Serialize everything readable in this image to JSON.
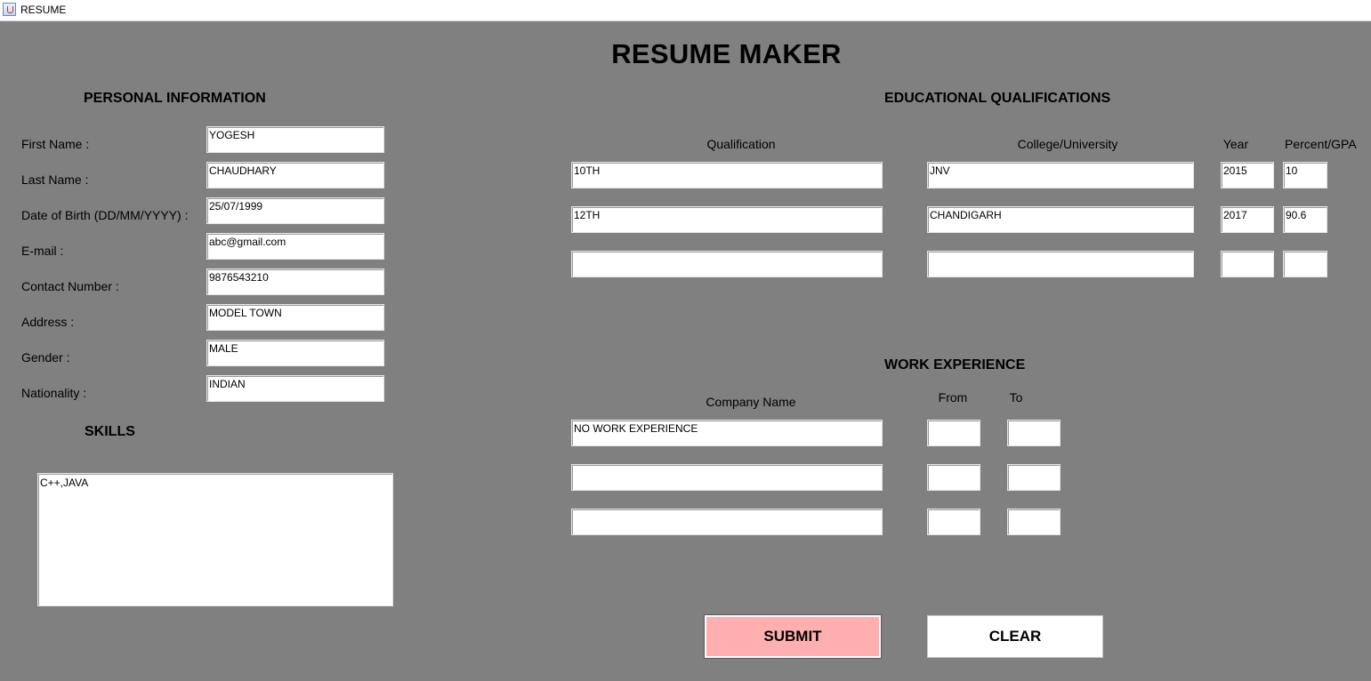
{
  "window": {
    "title": "RESUME",
    "icon": "java-app-icon"
  },
  "page_title": "RESUME MAKER",
  "personal": {
    "heading": "PERSONAL INFORMATION",
    "fields": [
      {
        "label": "First Name :",
        "value": "YOGESH"
      },
      {
        "label": "Last Name :",
        "value": "CHAUDHARY"
      },
      {
        "label": "Date of Birth (DD/MM/YYYY) :",
        "value": "25/07/1999"
      },
      {
        "label": "E-mail :",
        "value": "abc@gmail.com"
      },
      {
        "label": "Contact Number :",
        "value": "9876543210"
      },
      {
        "label": "Address :",
        "value": "MODEL TOWN"
      },
      {
        "label": "Gender :",
        "value": "MALE"
      },
      {
        "label": "Nationality :",
        "value": "INDIAN"
      }
    ]
  },
  "skills": {
    "heading": "SKILLS",
    "value": "C++,JAVA"
  },
  "education": {
    "heading": "EDUCATIONAL QUALIFICATIONS",
    "columns": {
      "qualification": "Qualification",
      "college": "College/University",
      "year": "Year",
      "percent": "Percent/GPA"
    },
    "rows": [
      {
        "qualification": "10TH",
        "college": "JNV",
        "year": "2015",
        "percent": "10"
      },
      {
        "qualification": "12TH",
        "college": "CHANDIGARH",
        "year": "2017",
        "percent": "90.6"
      },
      {
        "qualification": "",
        "college": "",
        "year": "",
        "percent": ""
      }
    ]
  },
  "work": {
    "heading": "WORK EXPERIENCE",
    "columns": {
      "company": "Company Name",
      "from": "From",
      "to": "To"
    },
    "rows": [
      {
        "company": "NO WORK EXPERIENCE",
        "from": "",
        "to": ""
      },
      {
        "company": "",
        "from": "",
        "to": ""
      },
      {
        "company": "",
        "from": "",
        "to": ""
      }
    ]
  },
  "buttons": {
    "submit": "SUBMIT",
    "clear": "CLEAR"
  },
  "colors": {
    "background": "#808080",
    "submit_bg": "#ffafaf",
    "clear_bg": "#ffffff"
  }
}
